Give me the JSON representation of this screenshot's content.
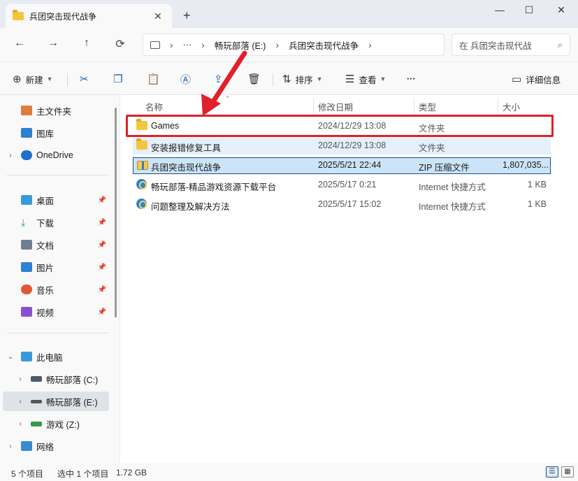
{
  "window": {
    "tab_title": "兵团突击现代战争",
    "tab_close": "✕",
    "new_tab": "+",
    "minimize": "—",
    "maximize": "☐",
    "close": "✕"
  },
  "address": {
    "more": "···",
    "crumbs": [
      "畅玩部落 (E:)",
      "兵团突击现代战争"
    ],
    "separator": "›",
    "search_placeholder": "在 兵团突击现代战",
    "search_icon": "search-icon"
  },
  "toolbar": {
    "new_label": "新建",
    "sort_label": "排序",
    "view_label": "查看",
    "more_label": "···",
    "details_label": "详细信息"
  },
  "sidebar": {
    "quick": [
      {
        "label": "主文件夹",
        "icon": "home-icon",
        "color": "#e07b39"
      },
      {
        "label": "图库",
        "icon": "gallery-icon",
        "color": "#2f7fcf"
      },
      {
        "label": "OneDrive",
        "icon": "cloud-icon",
        "color": "#1f6fd1"
      }
    ],
    "pinned": [
      {
        "label": "桌面",
        "icon": "desktop-icon",
        "color": "#3a9ad9"
      },
      {
        "label": "下载",
        "icon": "download-icon",
        "color": "#2e9b6b"
      },
      {
        "label": "文档",
        "icon": "documents-icon",
        "color": "#6f7f92"
      },
      {
        "label": "图片",
        "icon": "pictures-icon",
        "color": "#2f80d0"
      },
      {
        "label": "音乐",
        "icon": "music-icon",
        "color": "#e0583a"
      },
      {
        "label": "视频",
        "icon": "videos-icon",
        "color": "#8a4fd1"
      }
    ],
    "pc_label": "此电脑",
    "drives": [
      {
        "label": "畅玩部落 (C:)",
        "icon": "drive-c-icon"
      },
      {
        "label": "畅玩部落 (E:)",
        "icon": "drive-e-icon"
      },
      {
        "label": "游戏 (Z:)",
        "icon": "drive-z-icon"
      }
    ],
    "network_label": "网络"
  },
  "columns": {
    "name": "名称",
    "modified": "修改日期",
    "type": "类型",
    "size": "大小"
  },
  "files": [
    {
      "name": "Games",
      "modified": "2024/12/29 13:08",
      "type": "文件夹",
      "size": "",
      "kind": "folder"
    },
    {
      "name": "安装报错修复工具",
      "modified": "2024/12/29 13:08",
      "type": "文件夹",
      "size": "",
      "kind": "folder"
    },
    {
      "name": "兵团突击现代战争",
      "modified": "2025/5/21 22:44",
      "type": "ZIP 压缩文件",
      "size": "1,807,035...",
      "kind": "zip"
    },
    {
      "name": "畅玩部落-精品游戏资源下载平台",
      "modified": "2025/5/17 0:21",
      "type": "Internet 快捷方式",
      "size": "1 KB",
      "kind": "link"
    },
    {
      "name": "问题整理及解决方法",
      "modified": "2025/5/17 15:02",
      "type": "Internet 快捷方式",
      "size": "1 KB",
      "kind": "link"
    }
  ],
  "status": {
    "count": "5 个项目",
    "selected": "选中 1 个项目",
    "size": "1.72 GB"
  },
  "colors": {
    "highlight": "#e0202a",
    "selection": "#cce4f7"
  }
}
